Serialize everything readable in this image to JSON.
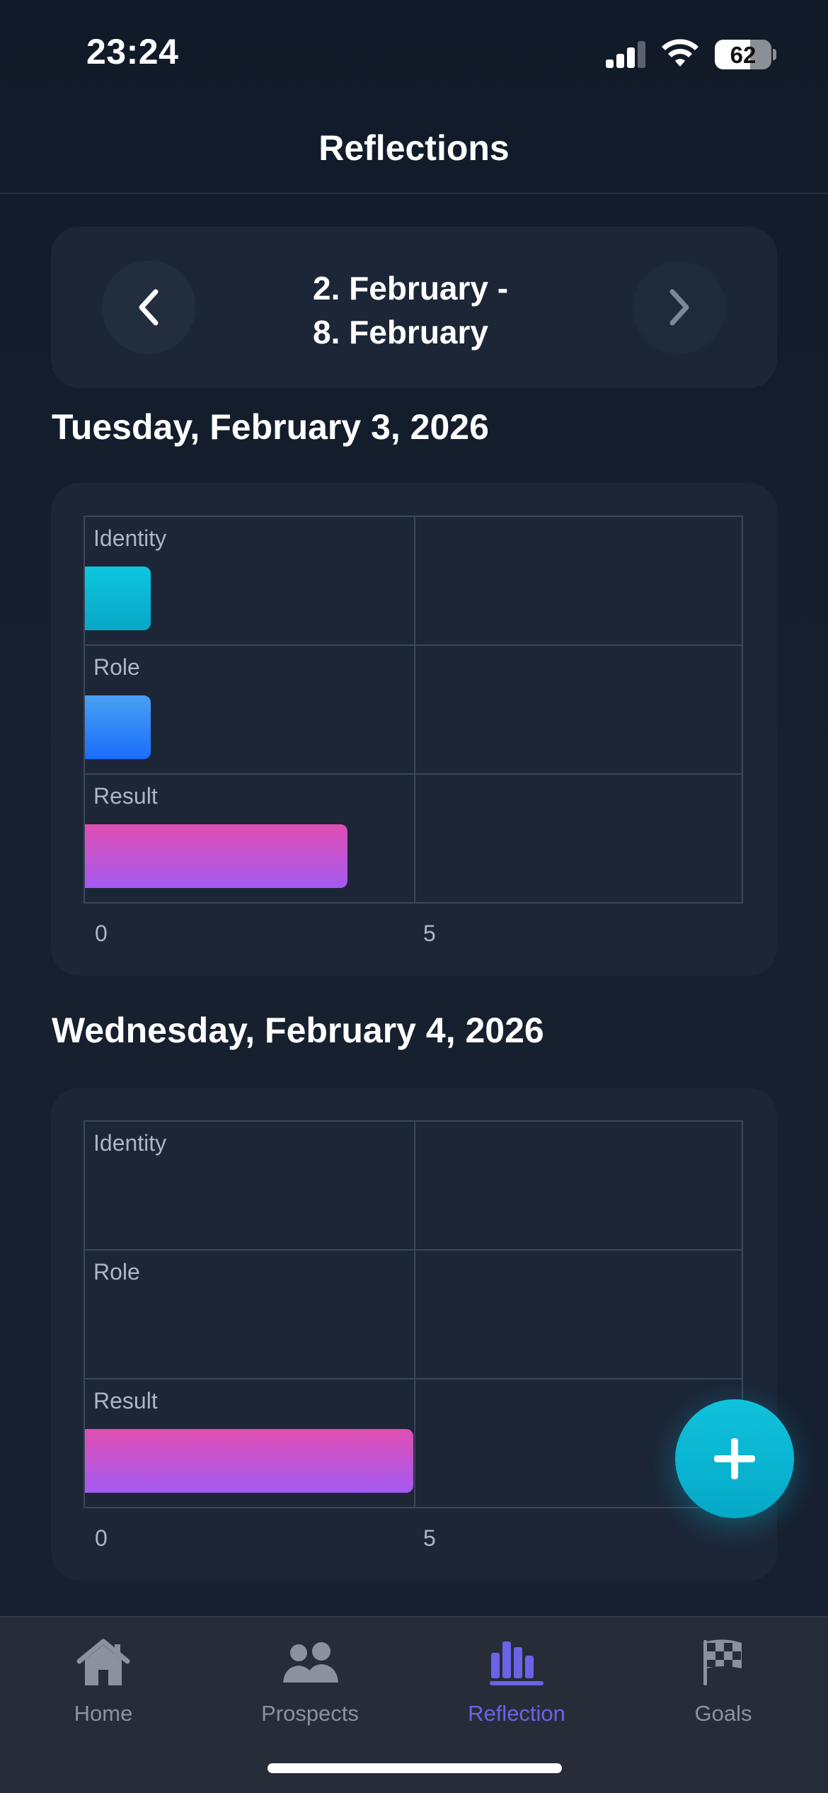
{
  "status_bar": {
    "time": "23:24",
    "battery": "62",
    "battery_level": 0.62
  },
  "header": {
    "title": "Reflections"
  },
  "week_selector": {
    "line1": "2. February -",
    "line2": "8. February",
    "prev_icon": "chevron-left-icon",
    "next_icon": "chevron-right-icon"
  },
  "days": [
    {
      "heading": "Tuesday, February 3, 2026",
      "chart": {
        "type": "bar",
        "categories": [
          "Identity",
          "Role",
          "Result"
        ],
        "values": [
          1,
          1,
          4
        ],
        "xticks": [
          "0",
          "5"
        ],
        "xlim": [
          0,
          10
        ],
        "grid": true
      }
    },
    {
      "heading": "Wednesday, February 4, 2026",
      "chart": {
        "type": "bar",
        "categories": [
          "Identity",
          "Role",
          "Result"
        ],
        "values": [
          0,
          0,
          5
        ],
        "xticks": [
          "0",
          "5"
        ],
        "xlim": [
          0,
          10
        ],
        "grid": true
      }
    }
  ],
  "chart_data": [
    {
      "type": "bar",
      "categories": [
        "Identity",
        "Role",
        "Result"
      ],
      "values": [
        1,
        1,
        4
      ],
      "xlim": [
        0,
        10
      ],
      "grid": true
    },
    {
      "type": "bar",
      "categories": [
        "Identity",
        "Role",
        "Result"
      ],
      "values": [
        0,
        0,
        5
      ],
      "xlim": [
        0,
        10
      ],
      "grid": true
    }
  ],
  "fab": {
    "icon": "plus-icon"
  },
  "tabs": [
    {
      "label": "Home",
      "icon": "home-icon",
      "active": false
    },
    {
      "label": "Prospects",
      "icon": "people-icon",
      "active": false
    },
    {
      "label": "Reflection",
      "icon": "bar-chart-icon",
      "active": true
    },
    {
      "label": "Goals",
      "icon": "checkered-flag-icon",
      "active": false
    }
  ],
  "colors": {
    "identity": "#0cc6e0",
    "role": "#1a6dfb",
    "result_top": "#e04eb2",
    "result_bottom": "#a35af1",
    "accent": "#6b63e6",
    "fab": "#05a9c8"
  }
}
